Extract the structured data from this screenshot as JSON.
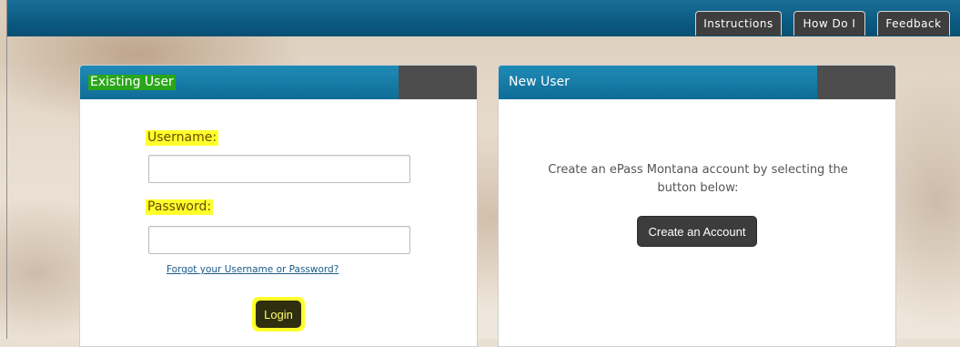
{
  "topnav": {
    "items": [
      {
        "label": "Instructions"
      },
      {
        "label": "How Do I"
      },
      {
        "label": "Feedback"
      }
    ]
  },
  "existing_user": {
    "title": "Existing User",
    "username_label": "Username:",
    "username_value": "",
    "password_label": "Password:",
    "password_value": "",
    "forgot_link": "Forgot your Username or Password?",
    "login_label": "Login"
  },
  "new_user": {
    "title": "New User",
    "description": "Create an ePass Montana account by selecting the button below:",
    "create_label": "Create an Account"
  },
  "colors": {
    "header_blue": "#0f6d97",
    "panel_head_blue": "#1f8bb6",
    "tab_dark": "#3e3e3e",
    "highlight_yellow": "#ffff2b",
    "highlight_green": "#29a61a"
  }
}
